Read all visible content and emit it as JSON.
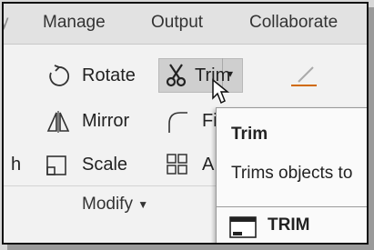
{
  "tabs": [
    "Manage",
    "Output",
    "Collaborate"
  ],
  "ribbon": {
    "rotate": "Rotate",
    "trim": "Trim",
    "mirror": "Mirror",
    "fillet_partial": "Fi",
    "scale": "Scale",
    "array_partial": "A",
    "left_cutoff": "h",
    "panel_title": "Modify"
  },
  "tooltip": {
    "title": "Trim",
    "description": "Trims objects to",
    "command": "TRIM"
  },
  "icons": [
    "rotate-icon",
    "scissors-icon",
    "dropdown-arrow-icon",
    "mirror-icon",
    "fillet-icon",
    "scale-icon",
    "array-icon",
    "cursor-arrow-icon",
    "command-line-icon",
    "pen-icon"
  ]
}
